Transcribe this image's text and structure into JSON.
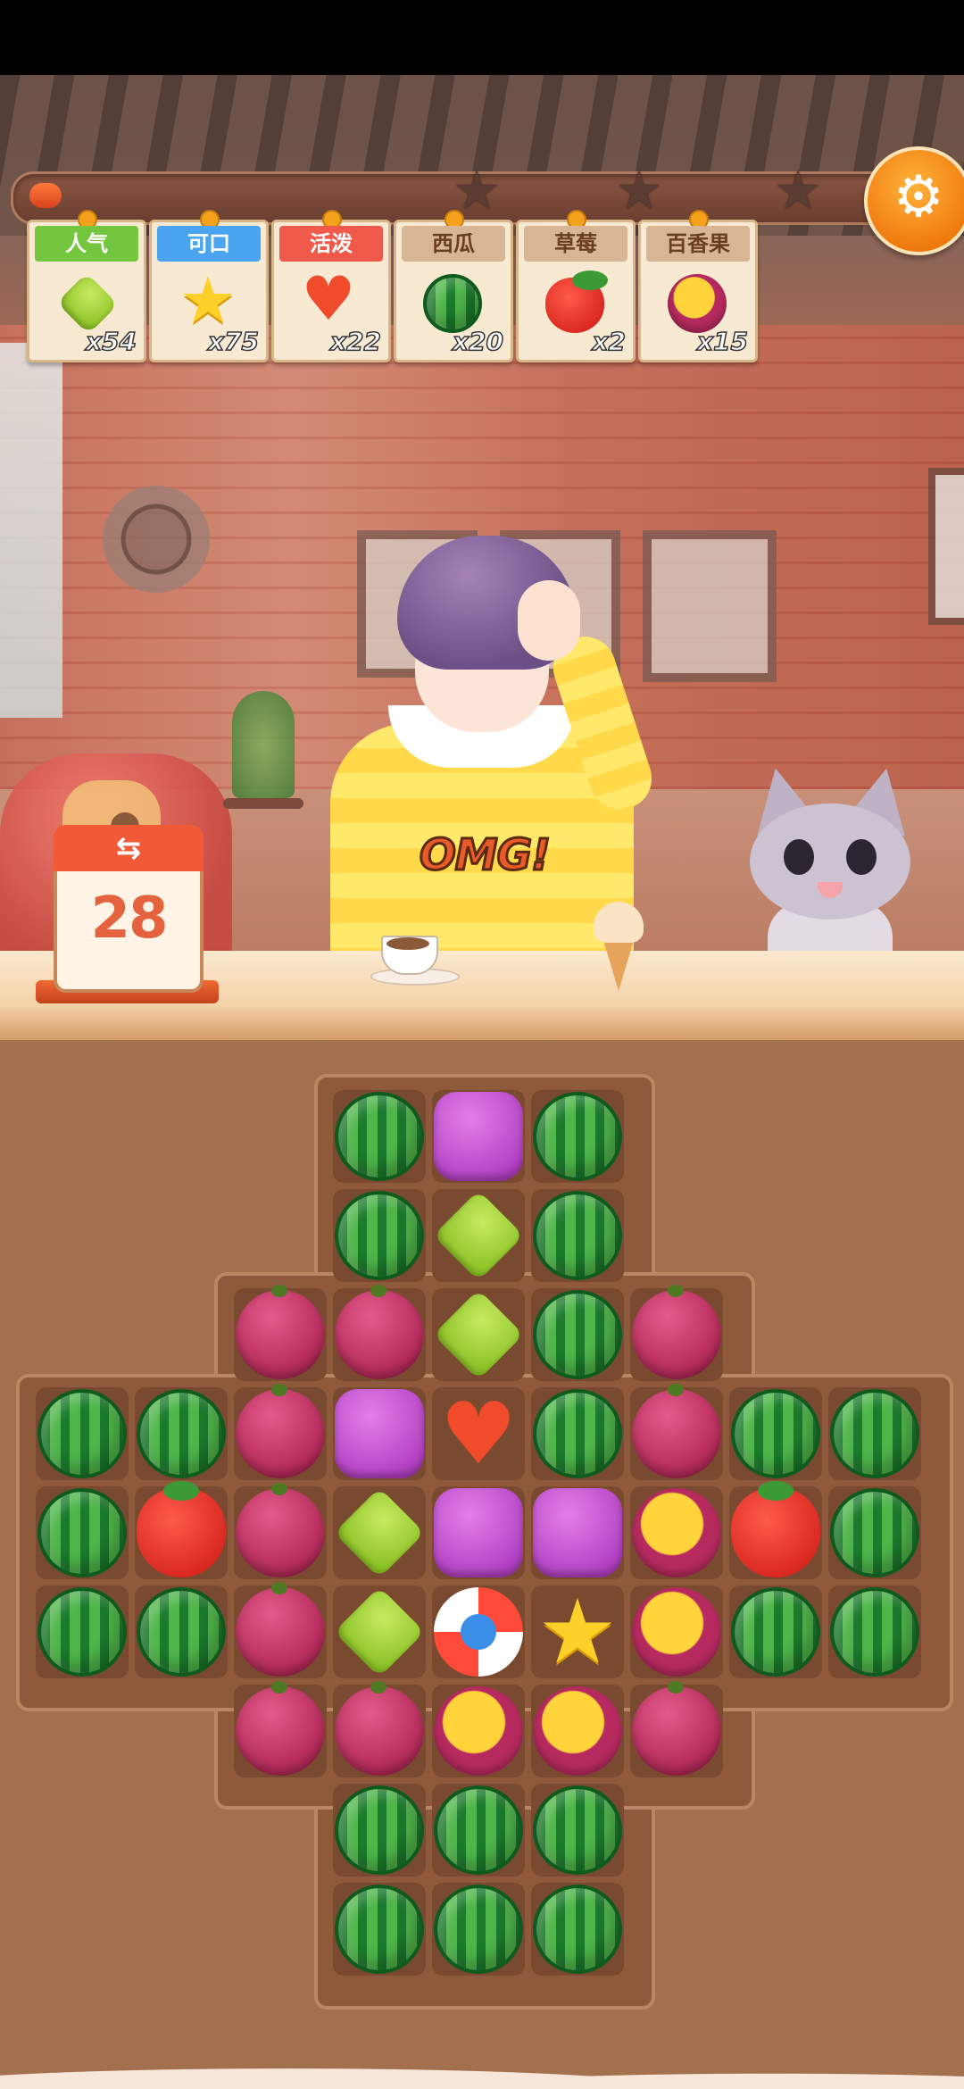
{
  "top_bar": {
    "progress_fraction": 0.03,
    "star_count": 3,
    "settings_icon": "gear-icon",
    "colors": {
      "accent": "#f07c0f",
      "progress": "#e0471f"
    }
  },
  "goals": [
    {
      "label": "人气",
      "label_color": "green",
      "icon": "green-diamond",
      "count": "x54"
    },
    {
      "label": "可口",
      "label_color": "blue",
      "icon": "yellow-star",
      "count": "x75"
    },
    {
      "label": "活泼",
      "label_color": "red",
      "icon": "red-heart",
      "count": "x22"
    },
    {
      "label": "西瓜",
      "label_color": "tan",
      "icon": "watermelon",
      "count": "x20"
    },
    {
      "label": "草莓",
      "label_color": "tan",
      "icon": "strawberry",
      "count": "x2"
    },
    {
      "label": "百香果",
      "label_color": "tan",
      "icon": "passion-fruit",
      "count": "x15"
    }
  ],
  "moves": {
    "icon": "swap-icon",
    "value": "28"
  },
  "character": {
    "shirt_text": "OMG!"
  },
  "board": {
    "legend": {
      "W": "watermelon",
      "P": "purple-block",
      "G": "green-diamond",
      "B": "berry",
      "H": "red-heart",
      "S": "strawberry",
      "F": "passion-fruit",
      "Y": "yellow-star",
      "L": "lifebuoy-booster"
    },
    "rows": [
      [
        "",
        "",
        "",
        "W",
        "P",
        "W",
        "",
        "",
        ""
      ],
      [
        "",
        "",
        "",
        "W",
        "G",
        "W",
        "",
        "",
        ""
      ],
      [
        "",
        "",
        "B",
        "B",
        "G",
        "W",
        "B",
        "",
        ""
      ],
      [
        "W",
        "W",
        "B",
        "P",
        "H",
        "W",
        "B",
        "W",
        "W"
      ],
      [
        "W",
        "S",
        "B",
        "G",
        "P",
        "P",
        "F",
        "S",
        "W"
      ],
      [
        "W",
        "W",
        "B",
        "G",
        "L",
        "Y",
        "F",
        "W",
        "W"
      ],
      [
        "",
        "",
        "B",
        "B",
        "F",
        "F",
        "B",
        "",
        ""
      ],
      [
        "",
        "",
        "",
        "W",
        "W",
        "W",
        "",
        "",
        ""
      ],
      [
        "",
        "",
        "",
        "W",
        "W",
        "W",
        "",
        "",
        ""
      ]
    ]
  }
}
